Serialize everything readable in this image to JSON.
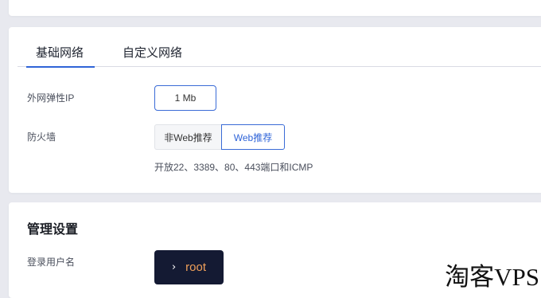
{
  "tabs": {
    "basic": "基础网络",
    "custom": "自定义网络"
  },
  "network": {
    "eip_label": "外网弹性IP",
    "bandwidth_value": "1 Mb",
    "firewall_label": "防火墙",
    "firewall_options": [
      "非Web推荐",
      "Web推荐"
    ],
    "firewall_selected": "Web推荐",
    "firewall_note": "开放22、3389、80、443端口和ICMP"
  },
  "management": {
    "title": "管理设置",
    "login_user_label": "登录用户名",
    "login_user_value": "root"
  },
  "watermark": "淘客VPS",
  "colors": {
    "accent": "#2f64d8",
    "terminal_bg": "#141a33",
    "terminal_text": "#f0a05a",
    "page_bg": "#e8e9ef"
  }
}
